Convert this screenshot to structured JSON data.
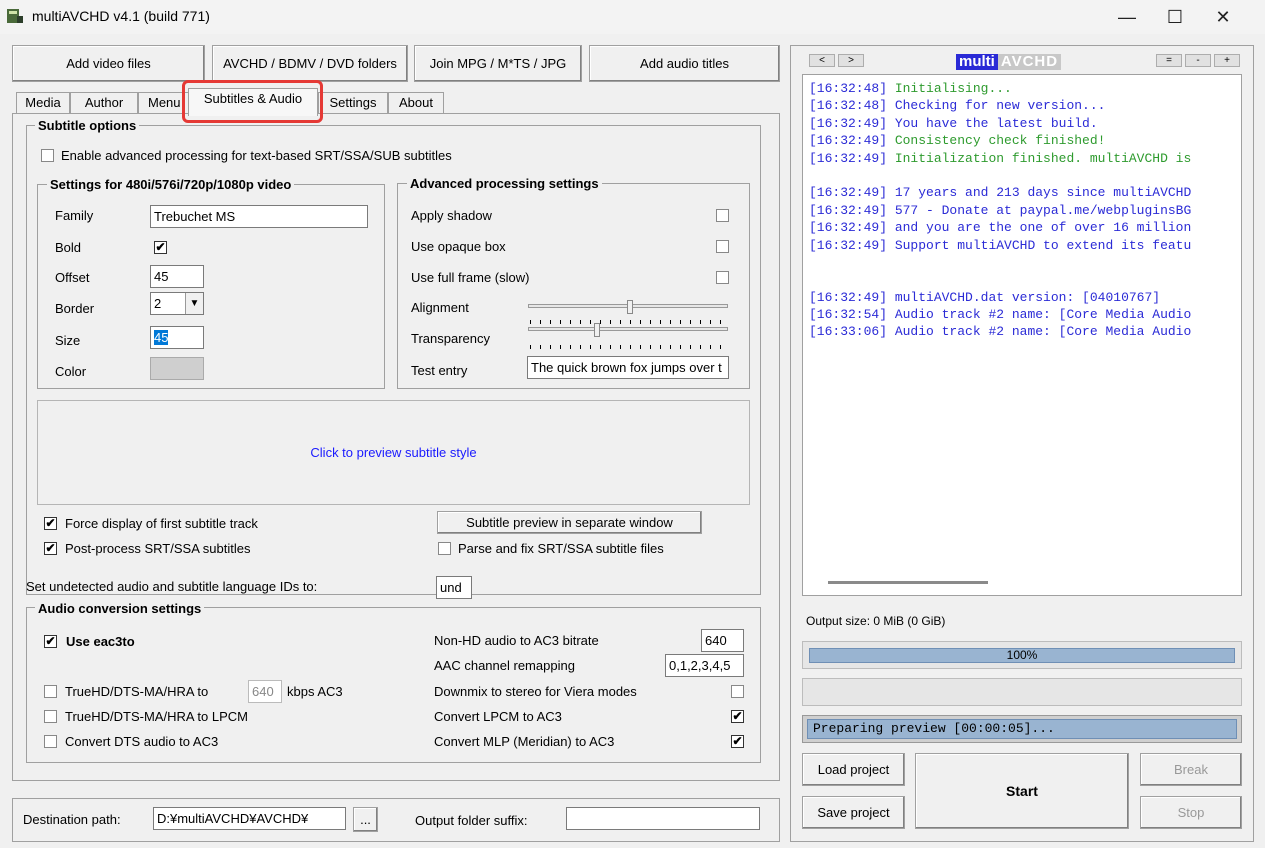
{
  "window": {
    "title": "multiAVCHD v4.1 (build 771)",
    "minimize": "—",
    "maximize": "☐",
    "close": "✕"
  },
  "toolbar": {
    "add_video": "Add video files",
    "avchd_folders": "AVCHD / BDMV / DVD folders",
    "join": "Join MPG / M*TS / JPG",
    "add_audio": "Add audio titles"
  },
  "tabs": [
    "Media",
    "Author",
    "Menu",
    "Subtitles & Audio",
    "Settings",
    "About"
  ],
  "subtitle_options": {
    "title": "Subtitle options",
    "enable_advanced": "Enable advanced processing for text-based SRT/SSA/SUB subtitles",
    "settings_group": {
      "title": "Settings for 480i/576i/720p/1080p video",
      "family_label": "Family",
      "family_value": "Trebuchet MS",
      "bold_label": "Bold",
      "offset_label": "Offset",
      "offset_value": "45",
      "border_label": "Border",
      "border_value": "2",
      "size_label": "Size",
      "size_value": "45",
      "color_label": "Color"
    },
    "advanced_group": {
      "title": "Advanced processing settings",
      "apply_shadow": "Apply shadow",
      "opaque_box": "Use opaque box",
      "full_frame": "Use full frame (slow)",
      "alignment": "Alignment",
      "transparency": "Transparency",
      "test_entry": "Test entry",
      "test_entry_value": "The quick brown fox jumps over t"
    },
    "preview_text": "Click to preview subtitle style",
    "force_display": "Force display of first subtitle track",
    "post_process": "Post-process SRT/SSA subtitles",
    "preview_window_button": "Subtitle preview in separate window",
    "parse_fix": "Parse and fix SRT/SSA subtitle files"
  },
  "language_ids": {
    "label": "Set undetected audio and subtitle language IDs to:",
    "value": "und"
  },
  "audio": {
    "title": "Audio conversion settings",
    "use_eac3to": "Use eac3to",
    "truehd_ac3": "TrueHD/DTS-MA/HRA to",
    "truehd_ac3_value": "640",
    "kbps_label": "kbps AC3",
    "truehd_lpcm": "TrueHD/DTS-MA/HRA to LPCM",
    "dts_ac3": "Convert DTS audio to AC3",
    "nonhd_label": "Non-HD audio to AC3 bitrate",
    "nonhd_value": "640",
    "aac_label": "AAC channel remapping",
    "aac_value": "0,1,2,3,4,5",
    "downmix": "Downmix to stereo for Viera modes",
    "lpcm_ac3": "Convert LPCM to AC3",
    "mlp_ac3": "Convert MLP (Meridian) to AC3"
  },
  "destination": {
    "label": "Destination path:",
    "value": "D:¥multiAVCHD¥AVCHD¥",
    "browse": "...",
    "suffix_label": "Output folder suffix:",
    "suffix_value": ""
  },
  "log_panel": {
    "nav_prev": "<",
    "nav_next": ">",
    "logo_left": "multi",
    "logo_right": "AVCHD",
    "size_eq": "=",
    "size_minus": "-",
    "size_plus": "+",
    "lines": [
      {
        "time": "[16:32:48]",
        "text": "Initialising...",
        "color": "#2e9b2e"
      },
      {
        "time": "[16:32:48]",
        "text": "Checking for new version...",
        "color": "#2b2bd6"
      },
      {
        "time": "[16:32:49]",
        "text": "You have the latest build.",
        "color": "#2b2bd6"
      },
      {
        "time": "[16:32:49]",
        "text": "Consistency check finished!",
        "color": "#2e9b2e"
      },
      {
        "time": "[16:32:49]",
        "text": "Initialization finished. multiAVCHD is",
        "color": "#2e9b2e"
      },
      {
        "time": "",
        "text": "",
        "color": "#000000"
      },
      {
        "time": "[16:32:49]",
        "text": "17 years and 213 days since multiAVCHD",
        "color": "#2b2bd6"
      },
      {
        "time": "[16:32:49]",
        "text": "577 - Donate at paypal.me/webpluginsBG",
        "color": "#2b2bd6"
      },
      {
        "time": "[16:32:49]",
        "text": "and you are the one of over 16 million",
        "color": "#2b2bd6"
      },
      {
        "time": "[16:32:49]",
        "text": "Support multiAVCHD to extend its featu",
        "color": "#2b2bd6"
      },
      {
        "time": "",
        "text": "",
        "color": "#000000"
      },
      {
        "time": "",
        "text": "",
        "color": "#000000"
      },
      {
        "time": "[16:32:49]",
        "text": "multiAVCHD.dat version: [04010767]",
        "color": "#2b2bd6"
      },
      {
        "time": "[16:32:54]",
        "text": "Audio track #2 name: [Core Media Audio",
        "color": "#2b2bd6"
      },
      {
        "time": "[16:33:06]",
        "text": "Audio track #2 name: [Core Media Audio",
        "color": "#2b2bd6"
      }
    ],
    "output_size": "Output size: 0 MiB (0 GiB)",
    "progress_label": "100%",
    "progress_value": 1.0,
    "status": "Preparing preview [00:00:05]...",
    "load_project": "Load project",
    "save_project": "Save project",
    "start": "Start",
    "break": "Break",
    "stop": "Stop"
  }
}
